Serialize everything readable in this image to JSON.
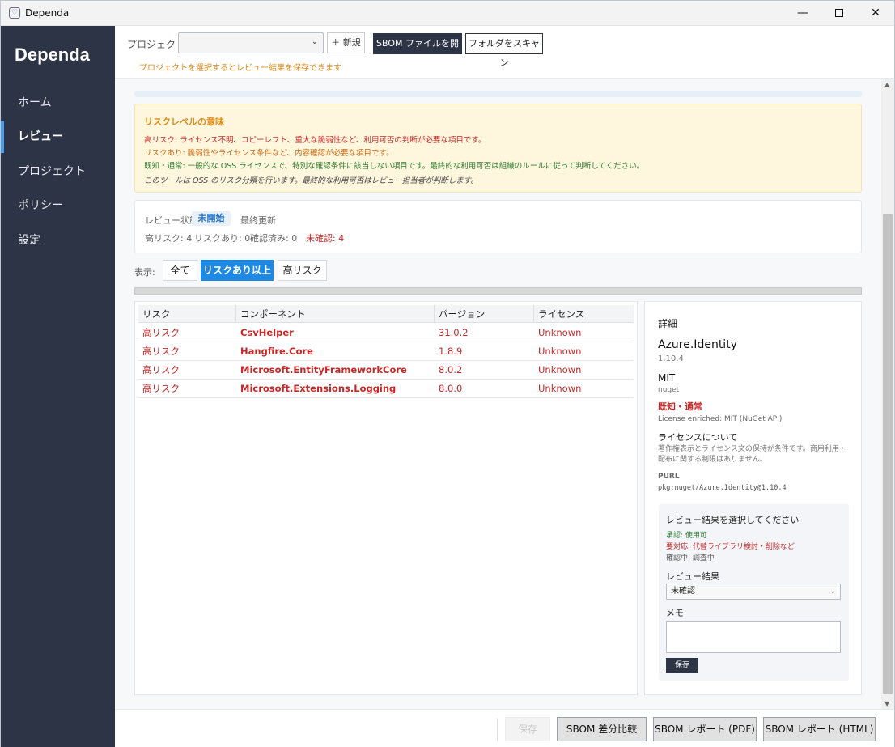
{
  "window": {
    "title": "Dependa",
    "minimize_glyph": "—",
    "close_glyph": "✕",
    "icon_glyph": "♡"
  },
  "sidebar": {
    "brand": "Dependa",
    "items": [
      {
        "label": "ホーム",
        "active": false
      },
      {
        "label": "レビュー",
        "active": true
      },
      {
        "label": "プロジェクト",
        "active": false
      },
      {
        "label": "ポリシー",
        "active": false
      },
      {
        "label": "設定",
        "active": false
      }
    ]
  },
  "toolbar": {
    "project_label": "プロジェクト:",
    "project_value": "",
    "new_button": "＋ 新規",
    "open_sbom_button": "SBOM ファイルを開く",
    "scan_folder_button": "フォルダをスキャン",
    "hint": "プロジェクトを選択するとレビュー結果を保存できます"
  },
  "legend": {
    "title": "リスクレベルの意味",
    "high": "高リスク: ライセンス不明、コピーレフト、重大な脆弱性など、利用可否の判断が必要な項目です。",
    "risk": "リスクあり: 脆弱性やライセンス条件など、内容確認が必要な項目です。",
    "known": "既知・通常: 一般的な OSS ライセンスで、特別な確認条件に該当しない項目です。最終的な利用可否は組織のルールに従って判断してください。",
    "note": "このツールは OSS のリスク分類を行います。最終的な利用可否はレビュー担当者が判断します。"
  },
  "status": {
    "label": "レビュー状態",
    "badge": "未開始",
    "updated": "最終更新",
    "high": "高リスク: 4",
    "risk": "リスクあり: 0",
    "confirmed": "確認済み: 0",
    "unconfirmed": "未確認: 4"
  },
  "filter": {
    "label": "表示:",
    "all": "全て",
    "risk_plus": "リスクあり以上",
    "high": "高リスク",
    "selected": "リスクあり以上"
  },
  "table": {
    "headers": [
      "リスク",
      "コンポーネント",
      "バージョン",
      "ライセンス"
    ],
    "rows": [
      [
        "高リスク",
        "CsvHelper",
        "31.0.2",
        "Unknown"
      ],
      [
        "高リスク",
        "Hangfire.Core",
        "1.8.9",
        "Unknown"
      ],
      [
        "高リスク",
        "Microsoft.EntityFrameworkCore",
        "8.0.2",
        "Unknown"
      ],
      [
        "高リスク",
        "Microsoft.Extensions.Logging",
        "8.0.0",
        "Unknown"
      ]
    ]
  },
  "detail": {
    "heading": "詳細",
    "name": "Azure.Identity",
    "version": "1.10.4",
    "license": "MIT",
    "ecosystem": "nuget",
    "classification": "既知・通常",
    "enriched": "License enriched: MIT (NuGet API)",
    "about_title": "ライセンスについて",
    "about_text": "著作権表示とライセンス文の保持が条件です。商用利用・配布に関する制限はありません。",
    "purl_label": "PURL",
    "purl": "pkg:nuget/Azure.Identity@1.10.4"
  },
  "review": {
    "title": "レビュー結果を選択してください",
    "approve": "承認: 使用可",
    "action": "要対応: 代替ライブラリ検討・削除など",
    "checking": "確認中: 調査中",
    "result_label": "レビュー結果",
    "result_value": "未確認",
    "memo_label": "メモ",
    "memo_value": "",
    "save_button": "保存"
  },
  "bottom": {
    "save": "保存",
    "diff": "SBOM 差分比較",
    "pdf": "SBOM レポート (PDF)",
    "html": "SBOM レポート (HTML)"
  },
  "colors": {
    "sidebar_bg": "#2c3446",
    "accent": "#1e88e5",
    "high_risk": "#c62828",
    "warning": "#e08a14",
    "ok": "#2e7d32"
  }
}
